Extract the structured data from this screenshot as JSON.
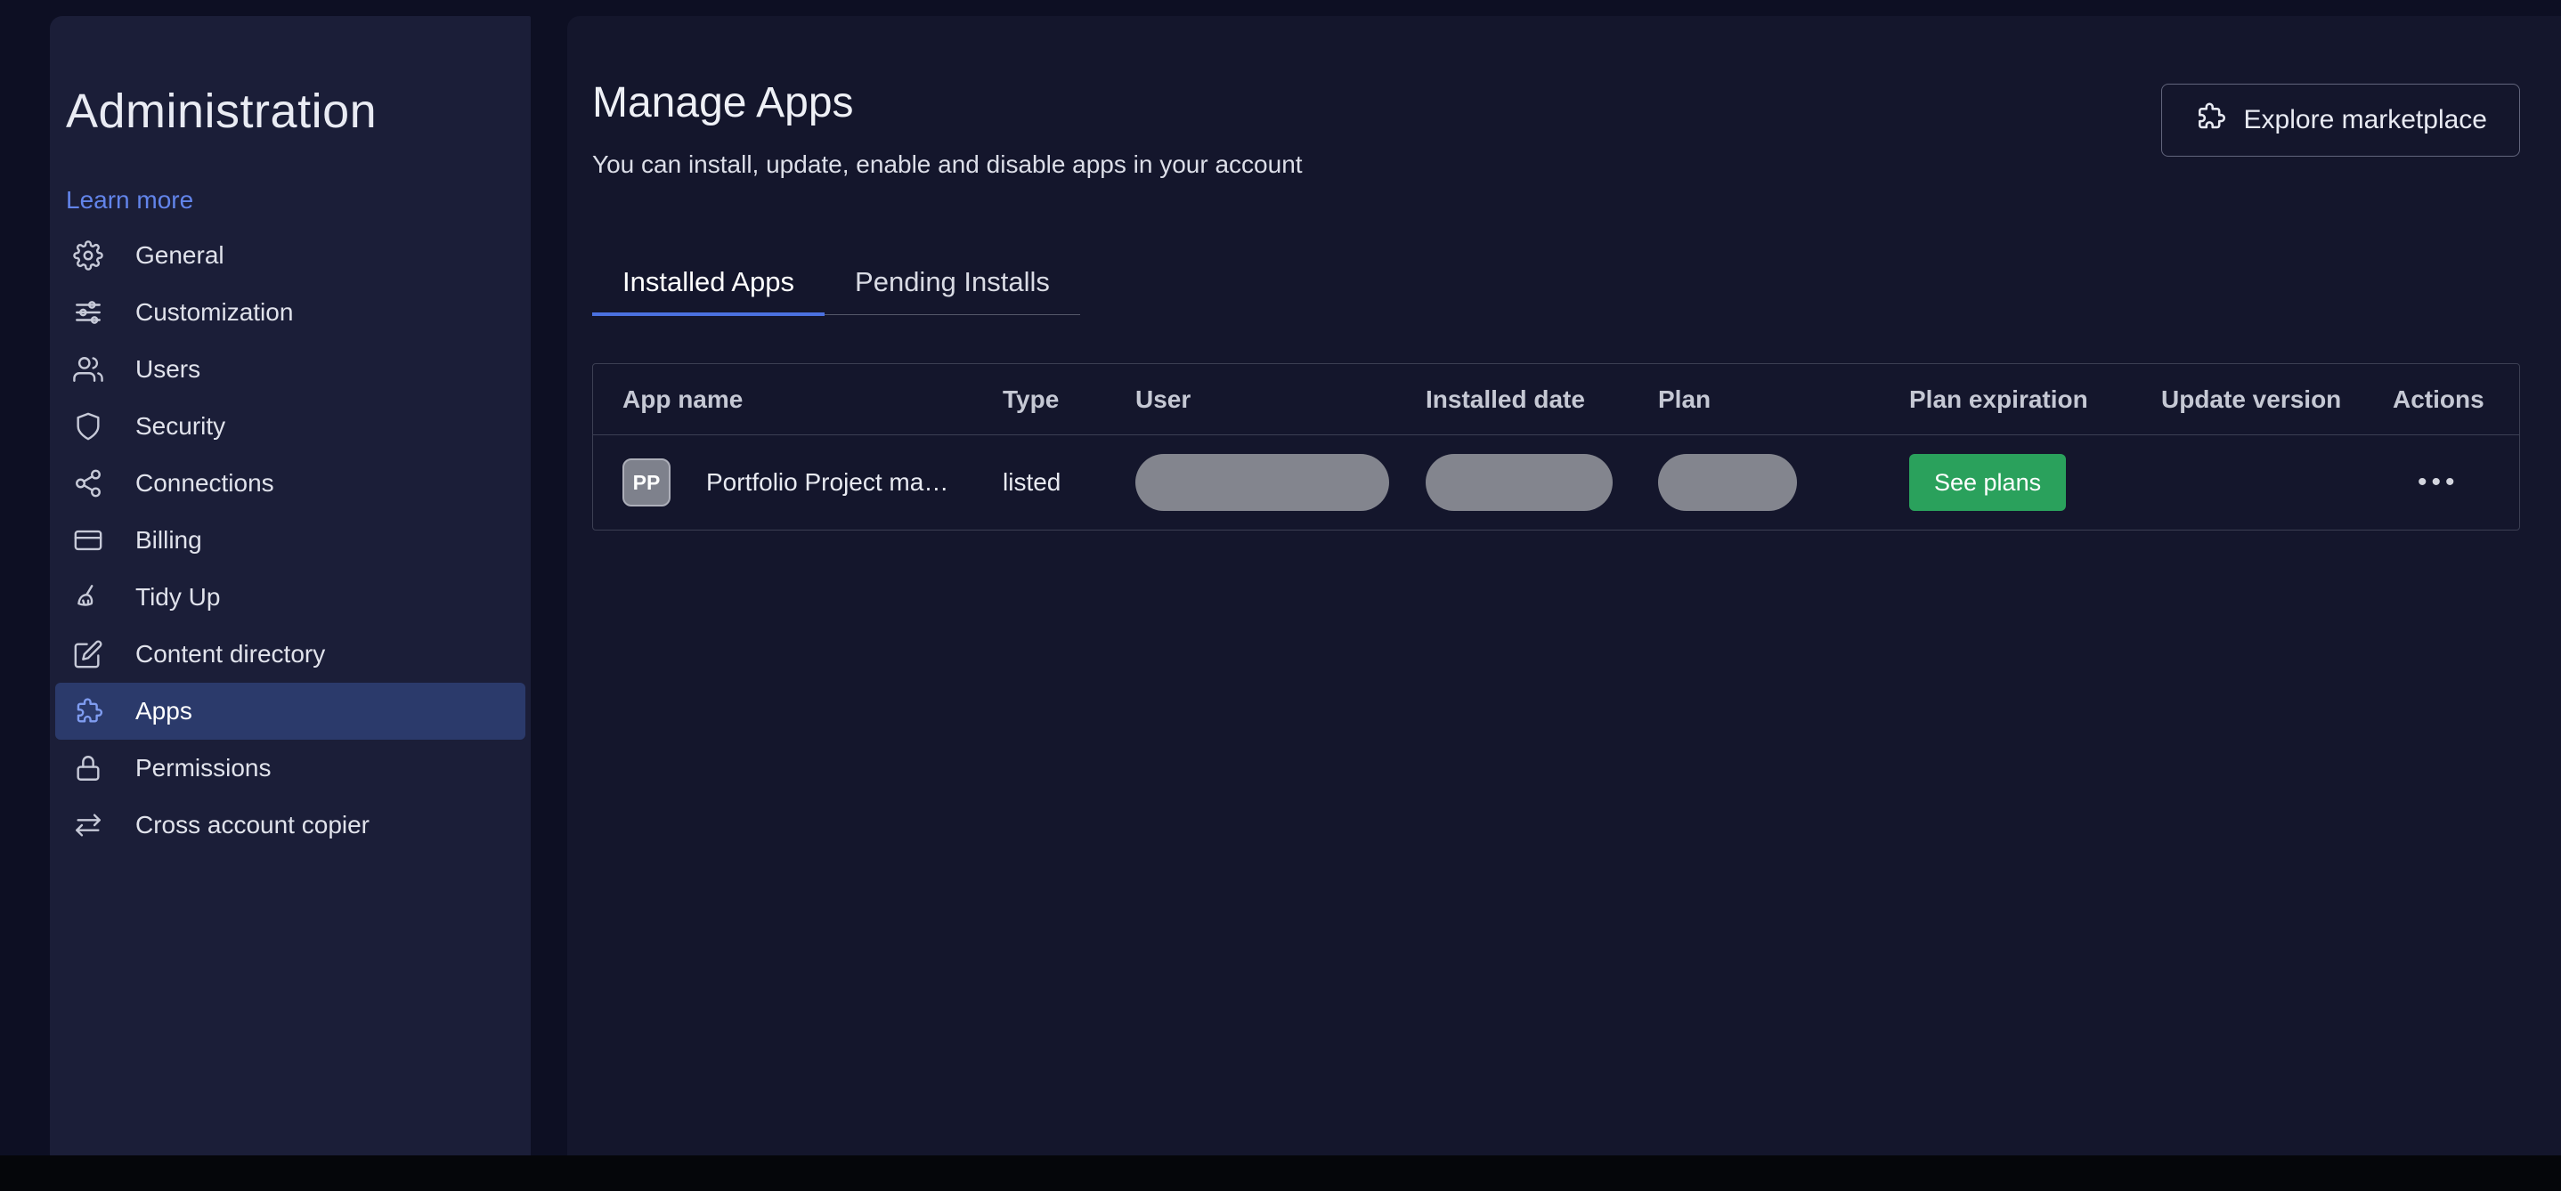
{
  "sidebar": {
    "title": "Administration",
    "learn_more_label": "Learn more",
    "selected_item": "Apps",
    "items": [
      {
        "label": "General",
        "icon": "gear-icon"
      },
      {
        "label": "Customization",
        "icon": "sliders-icon"
      },
      {
        "label": "Users",
        "icon": "users-icon"
      },
      {
        "label": "Security",
        "icon": "shield-icon"
      },
      {
        "label": "Connections",
        "icon": "nodes-icon"
      },
      {
        "label": "Billing",
        "icon": "credit-card-icon"
      },
      {
        "label": "Tidy Up",
        "icon": "broom-icon"
      },
      {
        "label": "Content directory",
        "icon": "document-pen-icon"
      },
      {
        "label": "Apps",
        "icon": "puzzle-icon"
      },
      {
        "label": "Permissions",
        "icon": "lock-icon"
      },
      {
        "label": "Cross account copier",
        "icon": "transfer-arrows-icon"
      }
    ]
  },
  "main": {
    "title": "Manage Apps",
    "subtitle": "You can install, update, enable and disable apps in your account",
    "explore_button_label": "Explore marketplace",
    "tabs": [
      {
        "label": "Installed Apps",
        "active": true
      },
      {
        "label": "Pending Installs",
        "active": false
      }
    ]
  },
  "table": {
    "columns": [
      "App name",
      "Type",
      "User",
      "Installed date",
      "Plan",
      "Plan expiration",
      "Update version",
      "Actions"
    ],
    "rows": [
      {
        "avatar_initials": "PP",
        "app_name": "Portfolio Project ma…",
        "type": "listed",
        "user_redacted": true,
        "installed_date_redacted": true,
        "plan_redacted": true,
        "plan_expiration_label": "See plans",
        "update_version": "",
        "actions_icon": "•••"
      }
    ]
  },
  "colors": {
    "accent_blue": "#4b71e0",
    "link_blue": "#6284ea",
    "selected_item_bg": "#2b3a6b",
    "green": "#2aa15c",
    "redacted_gray": "#8d8f97",
    "sidebar_bg": "#1b1e38",
    "main_bg": "#14162c"
  }
}
